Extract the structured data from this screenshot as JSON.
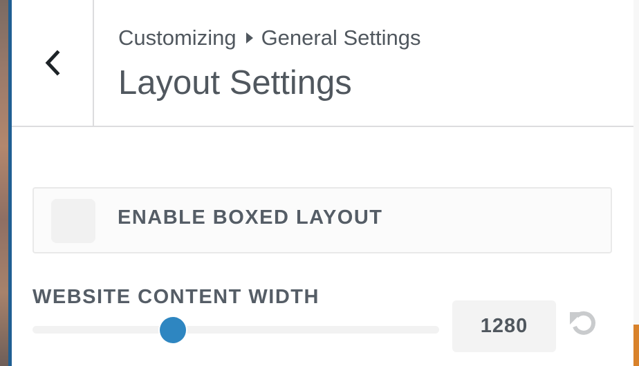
{
  "header": {
    "back_icon": "chevron-left-icon",
    "breadcrumb": [
      "Customizing",
      "General Settings"
    ],
    "breadcrumb_separator_icon": "caret-right-icon",
    "title": "Layout Settings"
  },
  "boxed_layout": {
    "label": "ENABLE BOXED LAYOUT",
    "checked": false
  },
  "content_width": {
    "label": "WEBSITE CONTENT WIDTH",
    "value": "1280",
    "slider_fraction": 0.345,
    "reset_icon": "undo-icon"
  },
  "colors": {
    "accent": "#2e86c1",
    "text": "#555d66",
    "border": "#dcdcde"
  }
}
